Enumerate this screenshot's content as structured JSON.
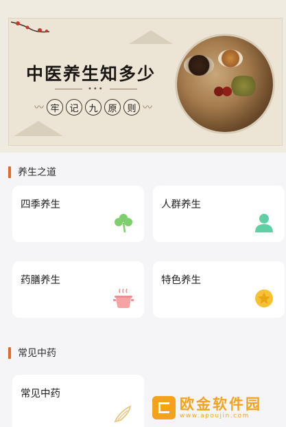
{
  "banner": {
    "title": "中医养生知多少",
    "dots": "•••",
    "pills": [
      "牢",
      "记",
      "九",
      "原",
      "则"
    ]
  },
  "sections": [
    {
      "title": "养生之道",
      "cards": [
        {
          "label": "四季养生",
          "icon": "clover-icon",
          "color": "#7ccf6a"
        },
        {
          "label": "人群养生",
          "icon": "people-icon",
          "color": "#5fd0a3"
        },
        {
          "label": "药膳养生",
          "icon": "pot-icon",
          "color": "#f08d8d"
        },
        {
          "label": "特色养生",
          "icon": "star-badge-icon",
          "color": "#f6c233"
        }
      ]
    },
    {
      "title": "常见中药",
      "cards": [
        {
          "label": "常见中药",
          "icon": "herb-slice-icon",
          "color": "#e8c98a"
        }
      ]
    }
  ],
  "watermark": {
    "text": "欧金软件园",
    "url": "www.apoujin.com"
  },
  "colors": {
    "accent": "#e16a2b",
    "card_bg": "#ffffff",
    "page_bg": "#f5f5f7",
    "watermark": "#f3a31b"
  }
}
